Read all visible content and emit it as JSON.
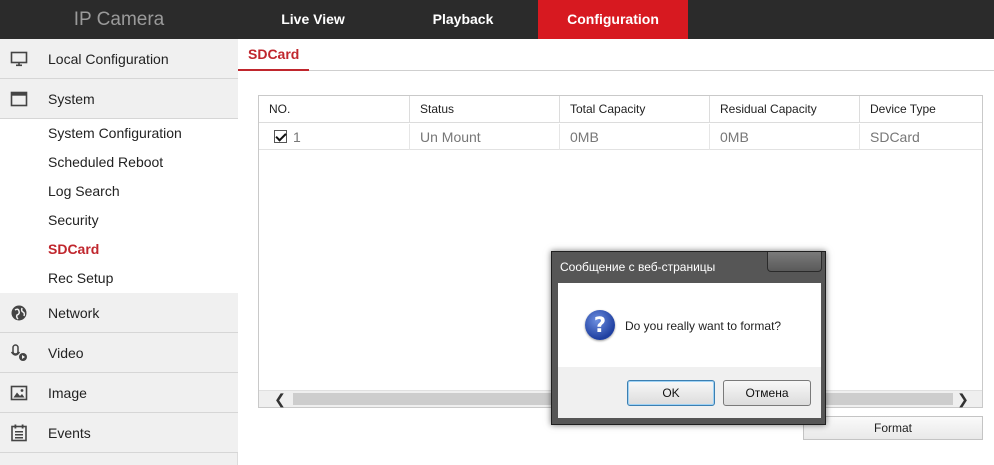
{
  "app": {
    "brand": "IP Camera"
  },
  "nav": {
    "tabs": [
      {
        "label": "Live View"
      },
      {
        "label": "Playback"
      },
      {
        "label": "Configuration",
        "active": true
      }
    ]
  },
  "sidebar": {
    "items": [
      {
        "label": "Local Configuration",
        "icon": "monitor-icon"
      },
      {
        "label": "System",
        "icon": "window-icon"
      },
      {
        "label": "Network",
        "icon": "globe-icon"
      },
      {
        "label": "Video",
        "icon": "microphone-video-icon"
      },
      {
        "label": "Image",
        "icon": "image-icon"
      },
      {
        "label": "Events",
        "icon": "calendar-list-icon"
      }
    ],
    "system_sub": [
      {
        "label": "System Configuration"
      },
      {
        "label": "Scheduled Reboot"
      },
      {
        "label": "Log Search"
      },
      {
        "label": "Security"
      },
      {
        "label": "SDCard",
        "active": true
      },
      {
        "label": "Rec Setup"
      }
    ]
  },
  "content": {
    "tab": "SDCard",
    "table": {
      "headers": [
        "NO.",
        "Status",
        "Total Capacity",
        "Residual Capacity",
        "Device Type"
      ],
      "rows": [
        {
          "checked": true,
          "no": "1",
          "status": "Un Mount",
          "total": "0MB",
          "residual": "0MB",
          "type": "SDCard"
        }
      ]
    },
    "format_button": "Format"
  },
  "dialog": {
    "title": "Сообщение с веб-страницы",
    "message": "Do you really want to format?",
    "icon": "question-icon",
    "ok": "OK",
    "cancel": "Отмена"
  },
  "colors": {
    "accent": "#d71920",
    "topbar": "#2b2b2b",
    "active_text": "#c0262d"
  }
}
